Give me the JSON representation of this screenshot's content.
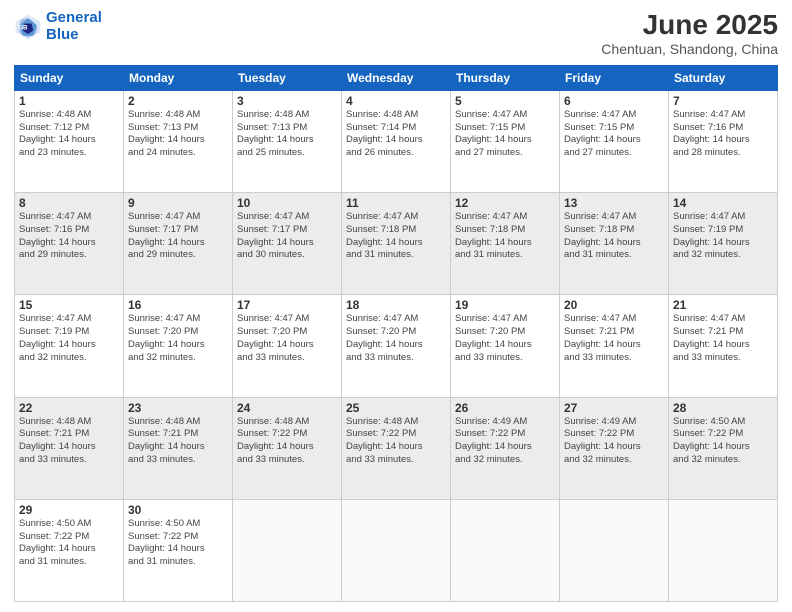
{
  "logo": {
    "line1": "General",
    "line2": "Blue"
  },
  "title": "June 2025",
  "subtitle": "Chentuan, Shandong, China",
  "headers": [
    "Sunday",
    "Monday",
    "Tuesday",
    "Wednesday",
    "Thursday",
    "Friday",
    "Saturday"
  ],
  "weeks": [
    [
      {
        "day": "1",
        "info": "Sunrise: 4:48 AM\nSunset: 7:12 PM\nDaylight: 14 hours\nand 23 minutes."
      },
      {
        "day": "2",
        "info": "Sunrise: 4:48 AM\nSunset: 7:13 PM\nDaylight: 14 hours\nand 24 minutes."
      },
      {
        "day": "3",
        "info": "Sunrise: 4:48 AM\nSunset: 7:13 PM\nDaylight: 14 hours\nand 25 minutes."
      },
      {
        "day": "4",
        "info": "Sunrise: 4:48 AM\nSunset: 7:14 PM\nDaylight: 14 hours\nand 26 minutes."
      },
      {
        "day": "5",
        "info": "Sunrise: 4:47 AM\nSunset: 7:15 PM\nDaylight: 14 hours\nand 27 minutes."
      },
      {
        "day": "6",
        "info": "Sunrise: 4:47 AM\nSunset: 7:15 PM\nDaylight: 14 hours\nand 27 minutes."
      },
      {
        "day": "7",
        "info": "Sunrise: 4:47 AM\nSunset: 7:16 PM\nDaylight: 14 hours\nand 28 minutes."
      }
    ],
    [
      {
        "day": "8",
        "info": "Sunrise: 4:47 AM\nSunset: 7:16 PM\nDaylight: 14 hours\nand 29 minutes."
      },
      {
        "day": "9",
        "info": "Sunrise: 4:47 AM\nSunset: 7:17 PM\nDaylight: 14 hours\nand 29 minutes."
      },
      {
        "day": "10",
        "info": "Sunrise: 4:47 AM\nSunset: 7:17 PM\nDaylight: 14 hours\nand 30 minutes."
      },
      {
        "day": "11",
        "info": "Sunrise: 4:47 AM\nSunset: 7:18 PM\nDaylight: 14 hours\nand 31 minutes."
      },
      {
        "day": "12",
        "info": "Sunrise: 4:47 AM\nSunset: 7:18 PM\nDaylight: 14 hours\nand 31 minutes."
      },
      {
        "day": "13",
        "info": "Sunrise: 4:47 AM\nSunset: 7:18 PM\nDaylight: 14 hours\nand 31 minutes."
      },
      {
        "day": "14",
        "info": "Sunrise: 4:47 AM\nSunset: 7:19 PM\nDaylight: 14 hours\nand 32 minutes."
      }
    ],
    [
      {
        "day": "15",
        "info": "Sunrise: 4:47 AM\nSunset: 7:19 PM\nDaylight: 14 hours\nand 32 minutes."
      },
      {
        "day": "16",
        "info": "Sunrise: 4:47 AM\nSunset: 7:20 PM\nDaylight: 14 hours\nand 32 minutes."
      },
      {
        "day": "17",
        "info": "Sunrise: 4:47 AM\nSunset: 7:20 PM\nDaylight: 14 hours\nand 33 minutes."
      },
      {
        "day": "18",
        "info": "Sunrise: 4:47 AM\nSunset: 7:20 PM\nDaylight: 14 hours\nand 33 minutes."
      },
      {
        "day": "19",
        "info": "Sunrise: 4:47 AM\nSunset: 7:20 PM\nDaylight: 14 hours\nand 33 minutes."
      },
      {
        "day": "20",
        "info": "Sunrise: 4:47 AM\nSunset: 7:21 PM\nDaylight: 14 hours\nand 33 minutes."
      },
      {
        "day": "21",
        "info": "Sunrise: 4:47 AM\nSunset: 7:21 PM\nDaylight: 14 hours\nand 33 minutes."
      }
    ],
    [
      {
        "day": "22",
        "info": "Sunrise: 4:48 AM\nSunset: 7:21 PM\nDaylight: 14 hours\nand 33 minutes."
      },
      {
        "day": "23",
        "info": "Sunrise: 4:48 AM\nSunset: 7:21 PM\nDaylight: 14 hours\nand 33 minutes."
      },
      {
        "day": "24",
        "info": "Sunrise: 4:48 AM\nSunset: 7:22 PM\nDaylight: 14 hours\nand 33 minutes."
      },
      {
        "day": "25",
        "info": "Sunrise: 4:48 AM\nSunset: 7:22 PM\nDaylight: 14 hours\nand 33 minutes."
      },
      {
        "day": "26",
        "info": "Sunrise: 4:49 AM\nSunset: 7:22 PM\nDaylight: 14 hours\nand 32 minutes."
      },
      {
        "day": "27",
        "info": "Sunrise: 4:49 AM\nSunset: 7:22 PM\nDaylight: 14 hours\nand 32 minutes."
      },
      {
        "day": "28",
        "info": "Sunrise: 4:50 AM\nSunset: 7:22 PM\nDaylight: 14 hours\nand 32 minutes."
      }
    ],
    [
      {
        "day": "29",
        "info": "Sunrise: 4:50 AM\nSunset: 7:22 PM\nDaylight: 14 hours\nand 31 minutes."
      },
      {
        "day": "30",
        "info": "Sunrise: 4:50 AM\nSunset: 7:22 PM\nDaylight: 14 hours\nand 31 minutes."
      },
      {
        "day": "",
        "info": ""
      },
      {
        "day": "",
        "info": ""
      },
      {
        "day": "",
        "info": ""
      },
      {
        "day": "",
        "info": ""
      },
      {
        "day": "",
        "info": ""
      }
    ]
  ]
}
